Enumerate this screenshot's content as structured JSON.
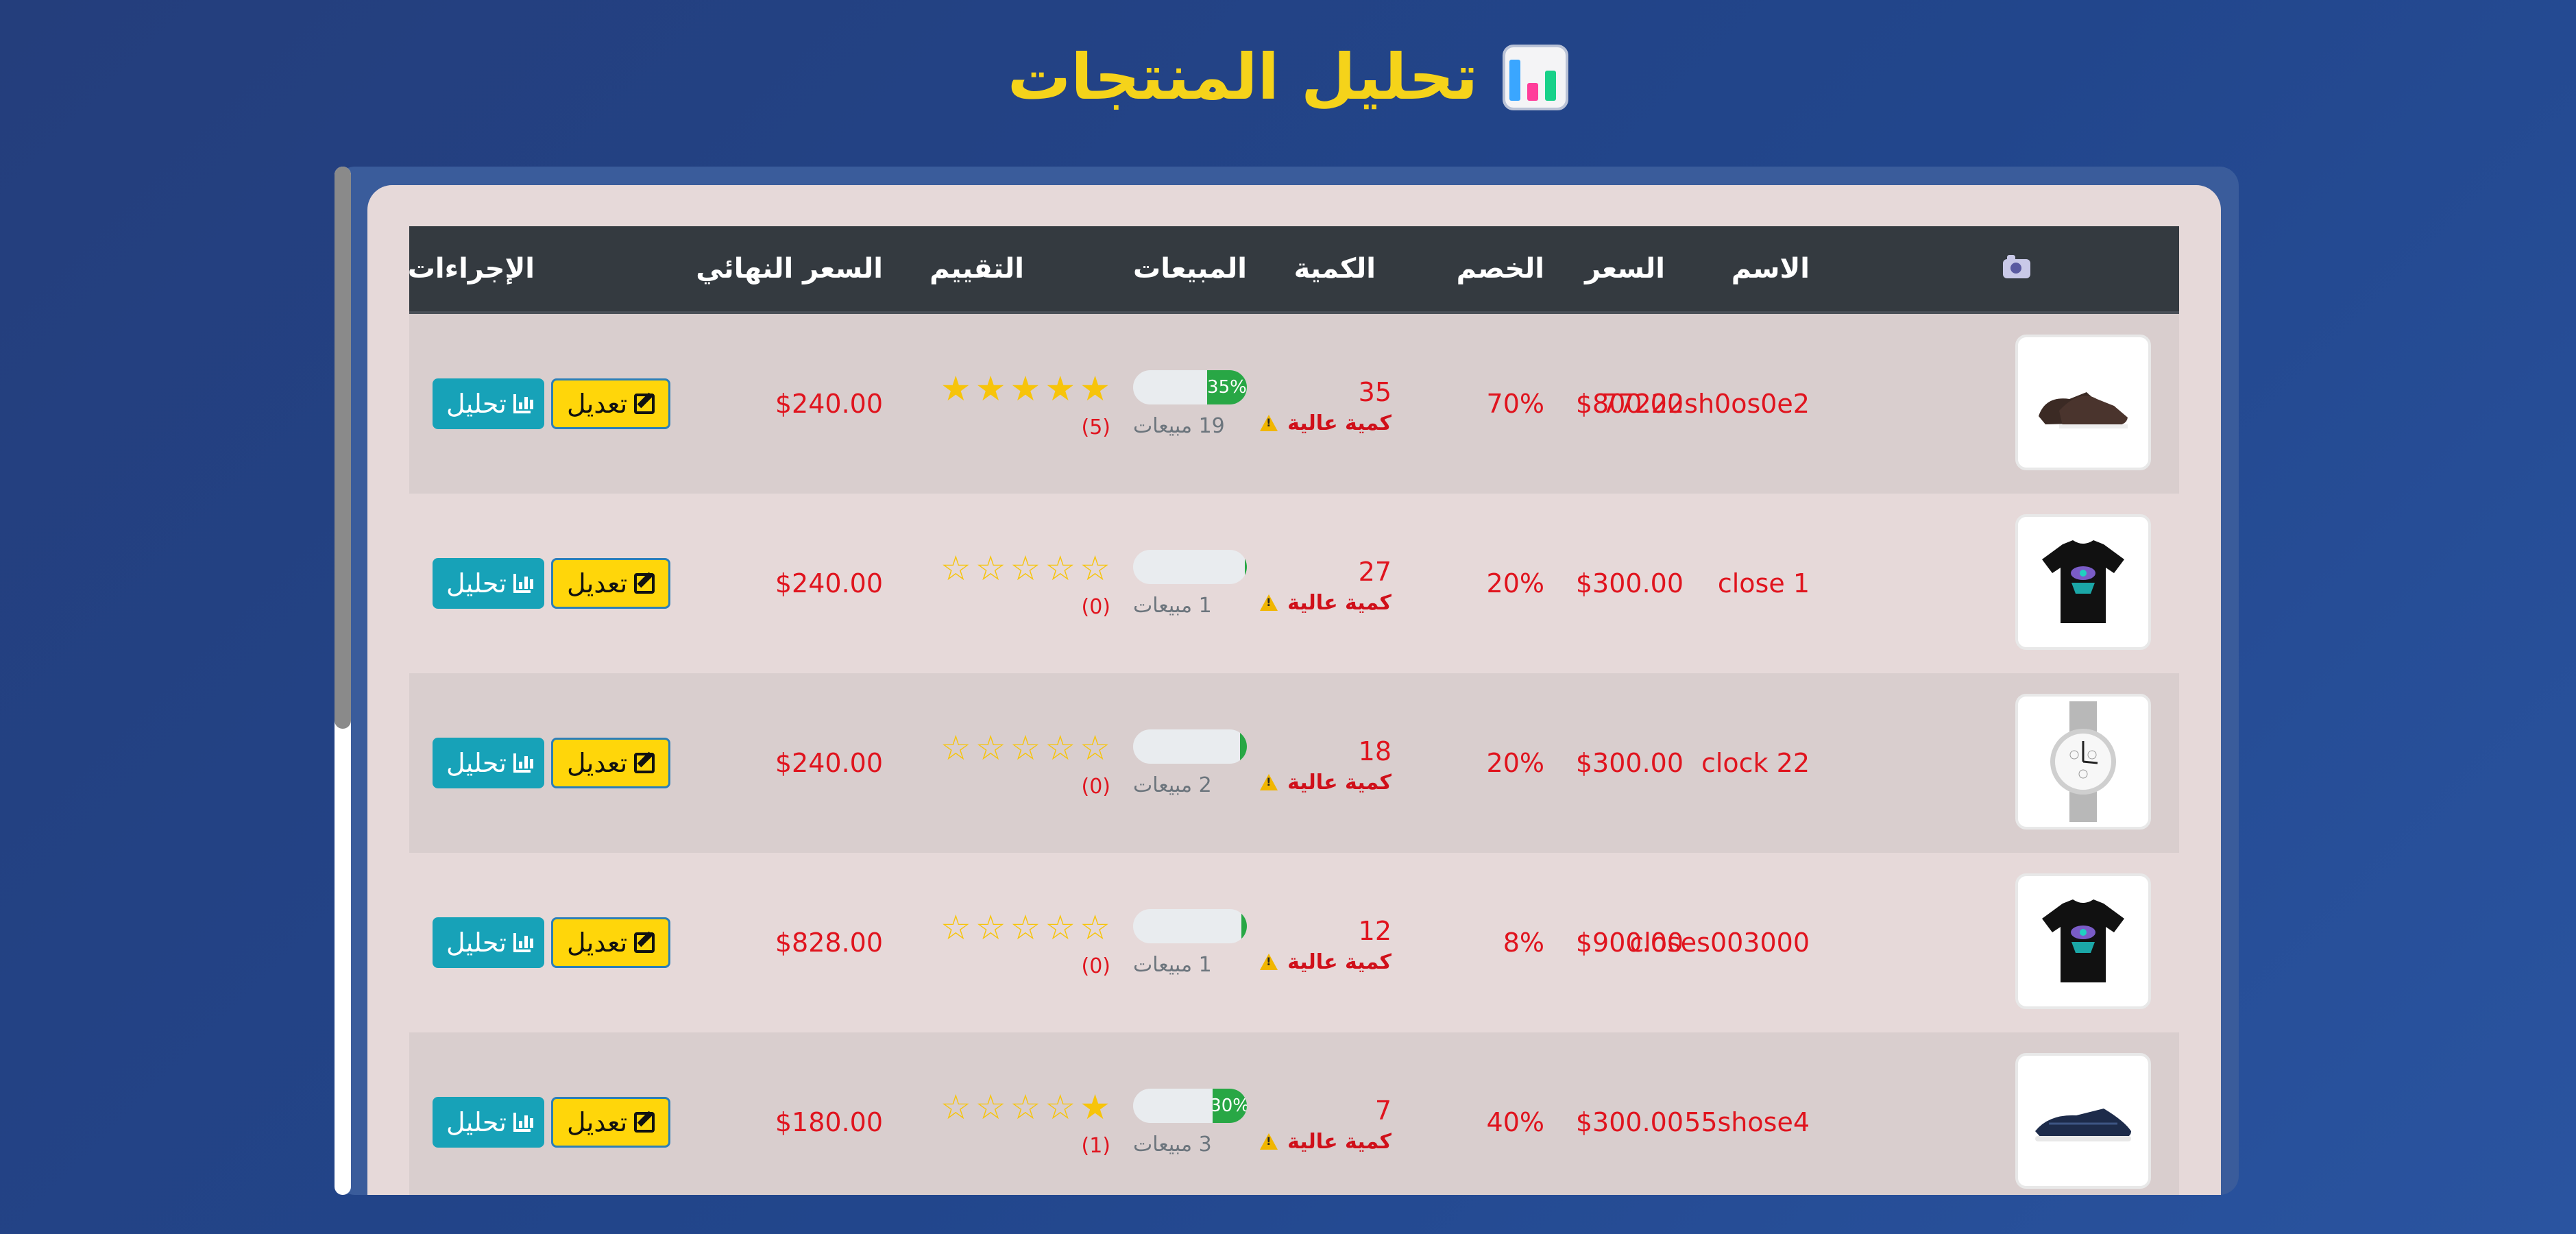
{
  "header": {
    "title": "تحليل المنتجات",
    "icon": "bar-chart-icon"
  },
  "table": {
    "columns": {
      "image": "📷",
      "name": "الاسم",
      "price": "السعر",
      "discount": "الخصم",
      "quantity": "الكمية",
      "sales": "المبيعات",
      "rating": "التقييم",
      "final_price": "السعر النهائي",
      "actions": "الإجراءات"
    },
    "rows": [
      {
        "image": "shoe-product-image",
        "name": "77222sh0os0e2",
        "price": "$800.00",
        "discount": "70%",
        "quantity": "35",
        "quantity_warning": "كمية عالية",
        "sales_percent": 35,
        "sales_label": "35%",
        "sales_text": "19 مبيعات",
        "rating_stars": 5,
        "rating_count": "(5)",
        "final_price": "$240.00",
        "edit_label": "تعديل",
        "analyze_label": "تحليل"
      },
      {
        "image": "tshirt-product-image",
        "name": "close 1",
        "price": "$300.00",
        "discount": "20%",
        "quantity": "27",
        "quantity_warning": "كمية عالية",
        "sales_percent": 2,
        "sales_label": "",
        "sales_text": "1 مبيعات",
        "rating_stars": 0,
        "rating_count": "(0)",
        "final_price": "$240.00",
        "edit_label": "تعديل",
        "analyze_label": "تحليل"
      },
      {
        "image": "watch-product-image",
        "name": "clock 22",
        "price": "$300.00",
        "discount": "20%",
        "quantity": "18",
        "quantity_warning": "كمية عالية",
        "sales_percent": 6,
        "sales_label": "",
        "sales_text": "2 مبيعات",
        "rating_stars": 0,
        "rating_count": "(0)",
        "final_price": "$240.00",
        "edit_label": "تعديل",
        "analyze_label": "تحليل"
      },
      {
        "image": "tshirt-product-image",
        "name": "closes003000",
        "price": "$900.00",
        "discount": "8%",
        "quantity": "12",
        "quantity_warning": "كمية عالية",
        "sales_percent": 5,
        "sales_label": "",
        "sales_text": "1 مبيعات",
        "rating_stars": 0,
        "rating_count": "(0)",
        "final_price": "$828.00",
        "edit_label": "تعديل",
        "analyze_label": "تحليل"
      },
      {
        "image": "sneaker-product-image",
        "name": "55shose4",
        "price": "$300.00",
        "discount": "40%",
        "quantity": "7",
        "quantity_warning": "كمية عالية",
        "sales_percent": 30,
        "sales_label": "30%",
        "sales_text": "3 مبيعات",
        "rating_stars": 1,
        "rating_count": "(1)",
        "final_price": "$180.00",
        "edit_label": "تعديل",
        "analyze_label": "تحليل"
      }
    ]
  },
  "colors": {
    "title": "#f5d31a",
    "header_bg": "#343a40",
    "text_red": "#e0141e",
    "progress_green": "#28a745",
    "edit_button": "#ffd60a",
    "analyze_button": "#17a2b8"
  }
}
